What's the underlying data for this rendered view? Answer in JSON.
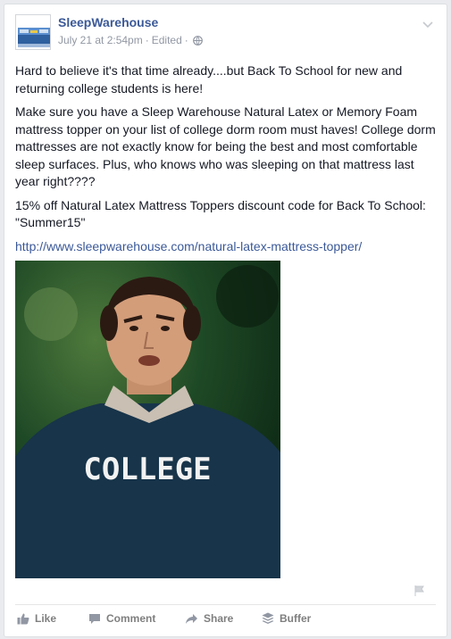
{
  "post": {
    "author": "SleepWarehouse",
    "date": "July 21 at 2:54pm",
    "edited": "Edited",
    "paragraphs": [
      "Hard to believe it's that time already....but Back To School for new and returning college students is here!",
      "Make sure you have a Sleep Warehouse Natural Latex or Memory Foam mattress topper on your list of college dorm room must haves! College dorm mattresses are not exactly know for being the best and most comfortable sleep surfaces. Plus, who knows who was sleeping on that mattress last year right????",
      "15% off Natural Latex Mattress Toppers discount code for Back To School: \"Summer15\""
    ],
    "link": "http://www.sleepwarehouse.com/natural-latex-mattress-topper/",
    "image_text": "COLLEGE"
  },
  "actions": {
    "like": "Like",
    "comment": "Comment",
    "share": "Share",
    "buffer": "Buffer"
  },
  "colors": {
    "link": "#3b5998",
    "meta": "#9197a3",
    "action": "#7f7f7f"
  }
}
